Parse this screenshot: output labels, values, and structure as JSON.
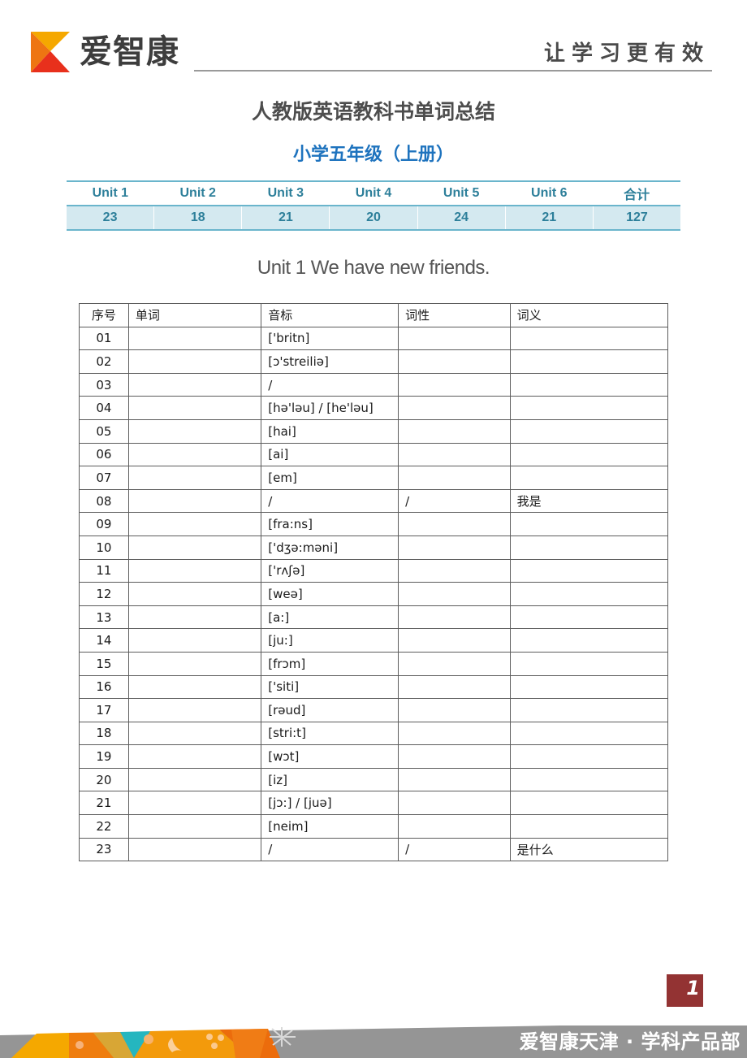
{
  "header": {
    "brand_name": "爱智康",
    "slogan": "让学习更有效",
    "logo_colors": [
      "#f5a800",
      "#ee7512",
      "#e8301c"
    ]
  },
  "title": "人教版英语教科书单词总结",
  "subtitle": "小学五年级（上册）",
  "summary": {
    "headers": [
      "Unit 1",
      "Unit 2",
      "Unit 3",
      "Unit 4",
      "Unit 5",
      "Unit 6",
      "合计"
    ],
    "values": [
      "23",
      "18",
      "21",
      "20",
      "24",
      "21",
      "127"
    ]
  },
  "unit_title": "Unit 1 We have new friends.",
  "vocab_table": {
    "columns": [
      "序号",
      "单词",
      "音标",
      "词性",
      "词义"
    ],
    "rows": [
      {
        "no": "01",
        "word": "",
        "phonetic": "['britn]",
        "pos": "",
        "meaning": ""
      },
      {
        "no": "02",
        "word": "",
        "phonetic": "[ɔ'streiliə]",
        "pos": "",
        "meaning": ""
      },
      {
        "no": "03",
        "word": "",
        "phonetic": "/",
        "pos": "",
        "meaning": ""
      },
      {
        "no": "04",
        "word": "",
        "phonetic": "[hə'ləu] / [he'ləu]",
        "pos": "",
        "meaning": ""
      },
      {
        "no": "05",
        "word": "",
        "phonetic": "[hai]",
        "pos": "",
        "meaning": ""
      },
      {
        "no": "06",
        "word": "",
        "phonetic": "[ai]",
        "pos": "",
        "meaning": ""
      },
      {
        "no": "07",
        "word": "",
        "phonetic": "[em]",
        "pos": "",
        "meaning": ""
      },
      {
        "no": "08",
        "word": "",
        "phonetic": "/",
        "pos": "/",
        "meaning": "我是"
      },
      {
        "no": "09",
        "word": "",
        "phonetic": "[fra:ns]",
        "pos": "",
        "meaning": ""
      },
      {
        "no": "10",
        "word": "",
        "phonetic": "['dʒə:məni]",
        "pos": "",
        "meaning": ""
      },
      {
        "no": "11",
        "word": "",
        "phonetic": "['rʌʃə]",
        "pos": "",
        "meaning": ""
      },
      {
        "no": "12",
        "word": "",
        "phonetic": "[weə]",
        "pos": "",
        "meaning": ""
      },
      {
        "no": "13",
        "word": "",
        "phonetic": "[a:]",
        "pos": "",
        "meaning": ""
      },
      {
        "no": "14",
        "word": "",
        "phonetic": "[ju:]",
        "pos": "",
        "meaning": ""
      },
      {
        "no": "15",
        "word": "",
        "phonetic": "[frɔm]",
        "pos": "",
        "meaning": ""
      },
      {
        "no": "16",
        "word": "",
        "phonetic": "['siti]",
        "pos": "",
        "meaning": ""
      },
      {
        "no": "17",
        "word": "",
        "phonetic": "[rəud]",
        "pos": "",
        "meaning": ""
      },
      {
        "no": "18",
        "word": "",
        "phonetic": "[stri:t]",
        "pos": "",
        "meaning": ""
      },
      {
        "no": "19",
        "word": "",
        "phonetic": "[wɔt]",
        "pos": "",
        "meaning": ""
      },
      {
        "no": "20",
        "word": "",
        "phonetic": "[iz]",
        "pos": "",
        "meaning": ""
      },
      {
        "no": "21",
        "word": "",
        "phonetic": "[jɔ:] / [juə]",
        "pos": "",
        "meaning": ""
      },
      {
        "no": "22",
        "word": "",
        "phonetic": "[neim]",
        "pos": "",
        "meaning": ""
      },
      {
        "no": "23",
        "word": "",
        "phonetic": "/",
        "pos": "/",
        "meaning": "是什么"
      }
    ]
  },
  "page_number": "1",
  "footer": {
    "text": "爱智康天津 · 学科产品部"
  }
}
